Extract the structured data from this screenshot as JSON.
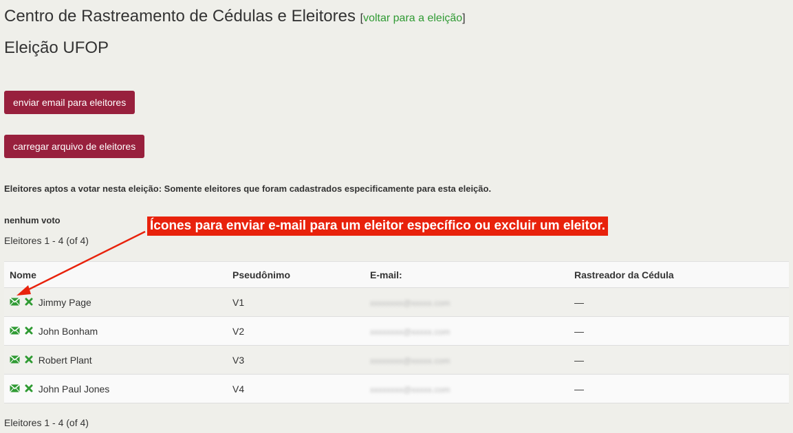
{
  "header": {
    "title": "Centro de Rastreamento de Cédulas e Eleitores",
    "back_link_open": "[",
    "back_link_label": "voltar para a eleição",
    "back_link_close": "]"
  },
  "election": {
    "name": "Eleição UFOP"
  },
  "buttons": {
    "email_voters": "enviar email para eleitores",
    "upload_voters": "carregar arquivo de eleitores"
  },
  "eligibility_text": "Eleitores aptos a votar nesta eleição: Somente eleitores que foram cadastrados especificamente para esta eleição.",
  "no_votes": "nenhum voto",
  "pagination": {
    "top": "Eleitores 1 - 4 (of 4)",
    "bottom": "Eleitores 1 - 4 (of 4)"
  },
  "annotation": {
    "text": "Ícones para enviar e-mail para um eleitor específico ou excluir um eleitor.",
    "color": "#e8220c"
  },
  "table": {
    "headers": [
      "Nome",
      "Pseudônimo",
      "E-mail:",
      "Rastreador da Cédula"
    ],
    "rows": [
      {
        "name": "Jimmy Page",
        "pseudonym": "V1",
        "email": "xxxxxxxx@xxxxx.com",
        "tracker": "—"
      },
      {
        "name": "John Bonham",
        "pseudonym": "V2",
        "email": "xxxxxxxx@xxxxx.com",
        "tracker": "—"
      },
      {
        "name": "Robert Plant",
        "pseudonym": "V3",
        "email": "xxxxxxxx@xxxxx.com",
        "tracker": "—"
      },
      {
        "name": "John Paul Jones",
        "pseudonym": "V4",
        "email": "xxxxxxxx@xxxxx.com",
        "tracker": "—"
      }
    ]
  },
  "icons": {
    "email": "envelope-icon",
    "delete": "x-delete-icon"
  },
  "colors": {
    "background": "#efefea",
    "button": "#98203d",
    "link": "#2f9a33",
    "icon_green": "#2f9a33",
    "annotation": "#e8220c"
  }
}
